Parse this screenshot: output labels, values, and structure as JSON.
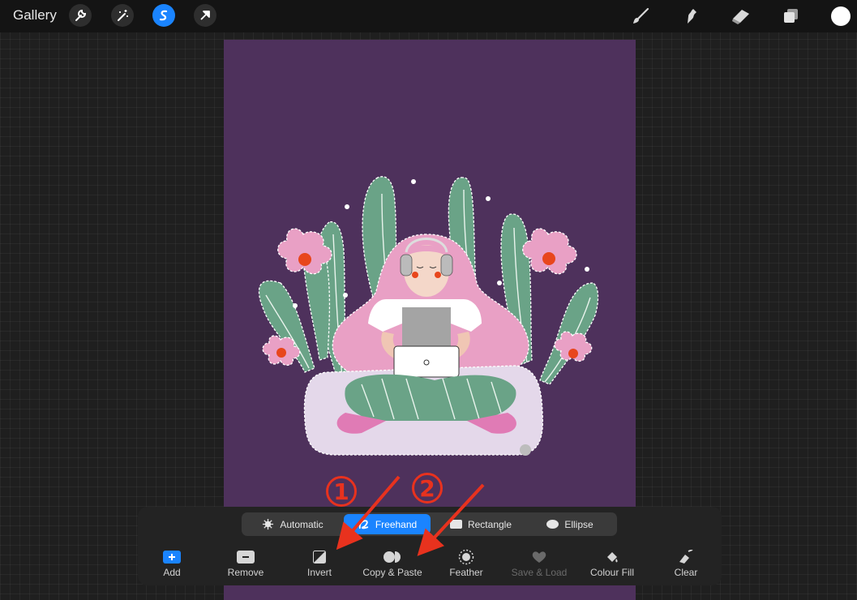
{
  "topbar": {
    "gallery_label": "Gallery",
    "left_tools": [
      "wrench-icon",
      "magic-wand-icon",
      "selection-icon",
      "transform-arrow-icon"
    ],
    "active_tool": "selection-icon",
    "right_tools": [
      "brush-icon",
      "smudge-icon",
      "eraser-icon",
      "layers-icon"
    ],
    "current_color": "#ffffff"
  },
  "selection": {
    "modes": [
      {
        "label": "Automatic",
        "icon": "burst-icon"
      },
      {
        "label": "Freehand",
        "icon": "freehand-icon",
        "active": true
      },
      {
        "label": "Rectangle",
        "icon": "rectangle-icon"
      },
      {
        "label": "Ellipse",
        "icon": "ellipse-icon"
      }
    ],
    "actions": [
      {
        "label": "Add",
        "icon": "plus-icon"
      },
      {
        "label": "Remove",
        "icon": "minus-icon"
      },
      {
        "label": "Invert",
        "icon": "invert-icon"
      },
      {
        "label": "Copy & Paste",
        "icon": "copy-paste-icon"
      },
      {
        "label": "Feather",
        "icon": "feather-icon"
      },
      {
        "label": "Save & Load",
        "icon": "heart-icon",
        "disabled": true
      },
      {
        "label": "Colour Fill",
        "icon": "fill-bucket-icon"
      },
      {
        "label": "Clear",
        "icon": "clear-broom-icon"
      }
    ]
  },
  "annotations": {
    "badges": [
      "1",
      "2"
    ]
  },
  "colors": {
    "accent": "#1a84ff",
    "canvas": "#4e315c",
    "annotation": "#e8321e"
  }
}
